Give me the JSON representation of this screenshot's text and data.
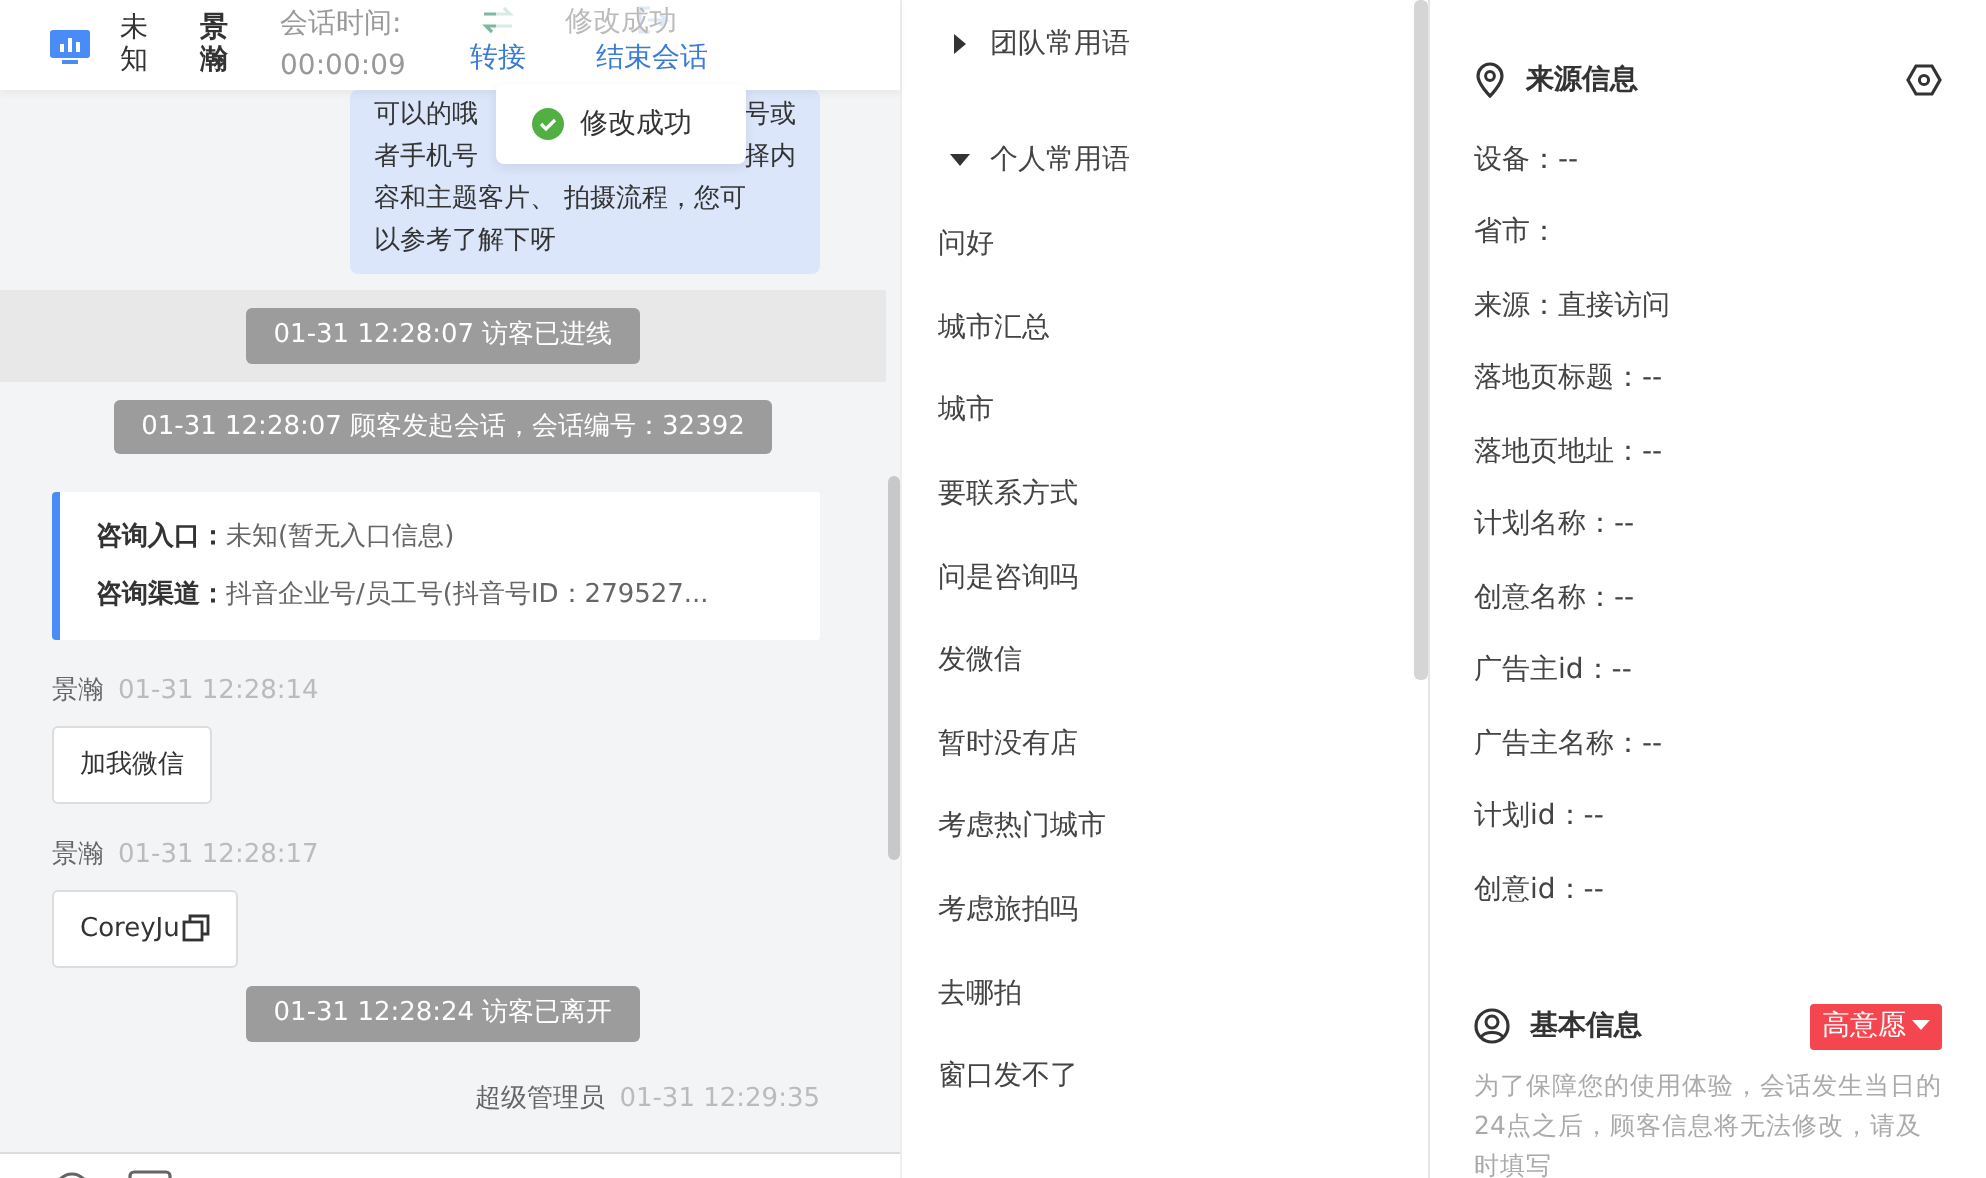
{
  "header": {
    "visitor": "未知",
    "agent": "景瀚",
    "session_label": "会话时间:",
    "session_time": "00:00:09",
    "actions": [
      {
        "label": "转接",
        "kind": "transfer"
      },
      {
        "label": "结束会话",
        "kind": "end"
      }
    ]
  },
  "toasts": [
    {
      "text": "修改成功",
      "faded": true
    },
    {
      "text": "修改成功",
      "faded": false
    }
  ],
  "messages": [
    {
      "kind": "bubble",
      "lines": [
        {
          "left": "可以的哦",
          "right": "号或"
        },
        {
          "left": "者手机号",
          "right": "择内"
        },
        {
          "text": "容和主题客片、 拍摄流程，您可"
        },
        {
          "text": "以参考了解下呀"
        }
      ]
    },
    {
      "kind": "system",
      "text": "01-31 12:28:07 访客已进线",
      "highlighted": true
    },
    {
      "kind": "system",
      "text": "01-31 12:28:07 顾客发起会话，会话编号：32392",
      "highlighted": false
    },
    {
      "kind": "card",
      "rows": [
        {
          "label": "咨询入口：",
          "value": "未知(暂无入口信息)"
        },
        {
          "label": "咨询渠道：",
          "value": "抖音企业号/员工号(抖音号ID：279527..."
        }
      ]
    },
    {
      "kind": "customer",
      "name": "景瀚",
      "time": "01-31 12:28:14",
      "text": "加我微信",
      "copyable": false
    },
    {
      "kind": "customer",
      "name": "景瀚",
      "time": "01-31 12:28:17",
      "text": "CoreyJu",
      "copyable": true
    },
    {
      "kind": "system",
      "text": "01-31 12:28:24 访客已离开",
      "highlighted": false
    },
    {
      "kind": "agent",
      "name": "超级管理员",
      "time": "01-31 12:29:35"
    }
  ],
  "phrases": [
    {
      "title": "团队常用语",
      "expanded": false
    },
    {
      "title": "个人常用语",
      "expanded": true,
      "items": [
        "问好",
        "城市汇总",
        "城市",
        "要联系方式",
        "问是咨询吗",
        "发微信",
        "暂时没有店",
        "考虑热门城市",
        "考虑旅拍吗",
        "去哪拍",
        "窗口发不了"
      ]
    }
  ],
  "source_info": {
    "title": "来源信息",
    "fields": [
      "设备：--",
      "省市：",
      "来源：直接访问",
      "落地页标题：--",
      "落地页地址：--",
      "计划名称：--",
      "创意名称：--",
      "广告主id：--",
      "广告主名称：--",
      "计划id：--",
      "创意id：--"
    ]
  },
  "basic_info": {
    "title": "基本信息",
    "tag": {
      "text": "高意愿",
      "color": "#f5454f"
    },
    "note": "为了保障您的使用体验，会话发生当日的24点之后，顾客信息将无法修改，请及时填写"
  }
}
